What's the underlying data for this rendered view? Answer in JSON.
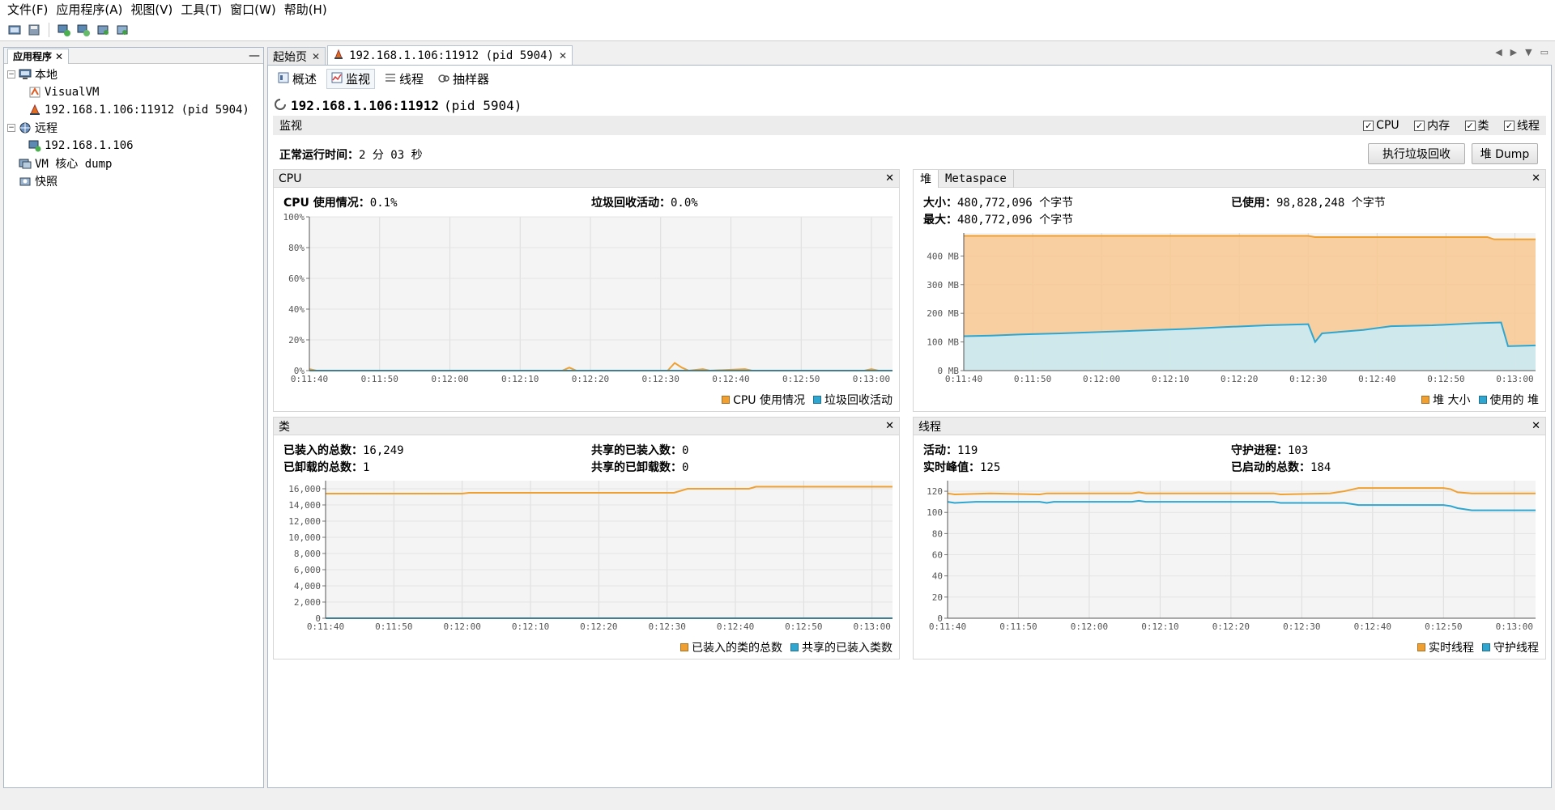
{
  "menu": [
    "文件(F)",
    "应用程序(A)",
    "视图(V)",
    "工具(T)",
    "窗口(W)",
    "帮助(H)"
  ],
  "left_panel": {
    "tab_label": "应用程序",
    "tree": [
      {
        "label": "本地",
        "level": 0,
        "icon": "computer-icon",
        "expand": "−"
      },
      {
        "label": "VisualVM",
        "level": 1,
        "icon": "visualvm-icon"
      },
      {
        "label": "192.168.1.106:11912 (pid 5904)",
        "level": 1,
        "icon": "java-app-icon"
      },
      {
        "label": "远程",
        "level": 0,
        "icon": "network-icon",
        "expand": "−"
      },
      {
        "label": "192.168.1.106",
        "level": 1,
        "icon": "remote-host-icon"
      },
      {
        "label": "VM 核心 dump",
        "level": 0,
        "icon": "core-dump-icon"
      },
      {
        "label": "快照",
        "level": 0,
        "icon": "snapshot-icon"
      }
    ]
  },
  "doc_tabs": [
    {
      "label": "起始页",
      "active": false
    },
    {
      "label": "192.168.1.106:11912 (pid 5904)",
      "active": true
    }
  ],
  "subtabs": [
    "概述",
    "监视",
    "线程",
    "抽样器"
  ],
  "process_title": {
    "host": "192.168.1.106:11912",
    "pid": "(pid 5904)"
  },
  "monitor": {
    "label": "监视",
    "checkboxes": [
      "CPU",
      "内存",
      "类",
      "线程"
    ],
    "uptime_label": "正常运行时间：",
    "uptime_value": "2 分 03 秒",
    "gc_button": "执行垃圾回收",
    "dump_button": "堆 Dump"
  },
  "cpu_panel": {
    "title": "CPU",
    "stats": [
      {
        "label": "CPU 使用情况：",
        "value": "0.1%"
      },
      {
        "label": "垃圾回收活动：",
        "value": "0.0%"
      }
    ],
    "legend": [
      "CPU 使用情况",
      "垃圾回收活动"
    ]
  },
  "heap_panel": {
    "tabs": [
      "堆",
      "Metaspace"
    ],
    "stats": [
      {
        "label": "大小：",
        "value": "480,772,096 个字节"
      },
      {
        "label": "最大：",
        "value": "480,772,096 个字节"
      },
      {
        "label": "已使用：",
        "value": "98,828,248 个字节"
      }
    ],
    "legend": [
      "堆 大小",
      "使用的 堆"
    ]
  },
  "classes_panel": {
    "title": "类",
    "stats": [
      {
        "label": "已装入的总数：",
        "value": "16,249"
      },
      {
        "label": "已卸载的总数：",
        "value": "1"
      },
      {
        "label": "共享的已装入数：",
        "value": "0"
      },
      {
        "label": "共享的已卸载数：",
        "value": "0"
      }
    ],
    "legend": [
      "已装入的类的总数",
      "共享的已装入类数"
    ]
  },
  "threads_panel": {
    "title": "线程",
    "stats": [
      {
        "label": "活动：",
        "value": "119"
      },
      {
        "label": "实时峰值：",
        "value": "125"
      },
      {
        "label": "守护进程：",
        "value": "103"
      },
      {
        "label": "已启动的总数：",
        "value": "184"
      }
    ],
    "legend": [
      "实时线程",
      "守护线程"
    ]
  },
  "colors": {
    "orange": "#f0a030",
    "blue": "#2ea6d0",
    "orange_fill": "#f8c890",
    "blue_fill": "#c8ecf8"
  },
  "chart_data": [
    {
      "type": "line",
      "id": "cpu",
      "x": [
        "0:11:40",
        "0:11:50",
        "0:12:00",
        "0:12:10",
        "0:12:20",
        "0:12:30",
        "0:12:40",
        "0:12:50",
        "0:13:00"
      ],
      "ylim": [
        0,
        100
      ],
      "yticks": [
        "0%",
        "20%",
        "40%",
        "60%",
        "80%",
        "100%"
      ],
      "series": [
        {
          "name": "CPU 使用情况",
          "color": "#f0a030",
          "points": [
            [
              0,
              1
            ],
            [
              1,
              0
            ],
            [
              36,
              0
            ],
            [
              37,
              2
            ],
            [
              38,
              0
            ],
            [
              51,
              0
            ],
            [
              52,
              5
            ],
            [
              53,
              2
            ],
            [
              54,
              0
            ],
            [
              56,
              1
            ],
            [
              57,
              0
            ],
            [
              62,
              1
            ],
            [
              63,
              0
            ],
            [
              79,
              0
            ],
            [
              80,
              1
            ],
            [
              81,
              0
            ]
          ]
        },
        {
          "name": "垃圾回收活动",
          "color": "#2ea6d0",
          "points": [
            [
              0,
              0
            ],
            [
              83,
              0
            ]
          ]
        }
      ]
    },
    {
      "type": "area",
      "id": "heap",
      "x": [
        "0:11:40",
        "0:11:50",
        "0:12:00",
        "0:12:10",
        "0:12:20",
        "0:12:30",
        "0:12:40",
        "0:12:50",
        "0:13:00"
      ],
      "ylim": [
        0,
        480
      ],
      "yticks": [
        "0 MB",
        "100 MB",
        "200 MB",
        "300 MB",
        "400 MB"
      ],
      "series": [
        {
          "name": "堆 大小",
          "color": "#f0a030",
          "points": [
            [
              0,
              470
            ],
            [
              50,
              470
            ],
            [
              51,
              466
            ],
            [
              76,
              466
            ],
            [
              77,
              458
            ],
            [
              83,
              458
            ]
          ]
        },
        {
          "name": "使用的 堆",
          "color": "#2ea6d0",
          "points": [
            [
              0,
              120
            ],
            [
              4,
              122
            ],
            [
              8,
              126
            ],
            [
              14,
              130
            ],
            [
              20,
              135
            ],
            [
              26,
              140
            ],
            [
              32,
              145
            ],
            [
              38,
              152
            ],
            [
              44,
              158
            ],
            [
              50,
              162
            ],
            [
              51,
              100
            ],
            [
              52,
              130
            ],
            [
              58,
              142
            ],
            [
              62,
              155
            ],
            [
              68,
              158
            ],
            [
              74,
              165
            ],
            [
              78,
              168
            ],
            [
              79,
              85
            ],
            [
              83,
              88
            ]
          ]
        }
      ]
    },
    {
      "type": "line",
      "id": "classes",
      "x": [
        "0:11:40",
        "0:11:50",
        "0:12:00",
        "0:12:10",
        "0:12:20",
        "0:12:30",
        "0:12:40",
        "0:12:50",
        "0:13:00"
      ],
      "ylim": [
        0,
        17000
      ],
      "yticks": [
        "0",
        "2,000",
        "4,000",
        "6,000",
        "8,000",
        "10,000",
        "12,000",
        "14,000",
        "16,000"
      ],
      "series": [
        {
          "name": "已装入的类的总数",
          "color": "#f0a030",
          "points": [
            [
              0,
              15400
            ],
            [
              20,
              15400
            ],
            [
              21,
              15500
            ],
            [
              51,
              15500
            ],
            [
              53,
              16000
            ],
            [
              62,
              16000
            ],
            [
              63,
              16249
            ],
            [
              83,
              16249
            ]
          ]
        },
        {
          "name": "共享的已装入类数",
          "color": "#2ea6d0",
          "points": [
            [
              0,
              0
            ],
            [
              83,
              0
            ]
          ]
        }
      ]
    },
    {
      "type": "line",
      "id": "threads",
      "x": [
        "0:11:40",
        "0:11:50",
        "0:12:00",
        "0:12:10",
        "0:12:20",
        "0:12:30",
        "0:12:40",
        "0:12:50",
        "0:13:00"
      ],
      "ylim": [
        0,
        130
      ],
      "yticks": [
        "0",
        "20",
        "40",
        "60",
        "80",
        "100",
        "120"
      ],
      "series": [
        {
          "name": "实时线程",
          "color": "#f0a030",
          "points": [
            [
              0,
              118
            ],
            [
              1,
              117
            ],
            [
              6,
              118
            ],
            [
              13,
              117
            ],
            [
              14,
              118
            ],
            [
              26,
              118
            ],
            [
              27,
              119
            ],
            [
              28,
              118
            ],
            [
              46,
              118
            ],
            [
              47,
              117
            ],
            [
              54,
              118
            ],
            [
              56,
              120
            ],
            [
              58,
              123
            ],
            [
              70,
              123
            ],
            [
              71,
              122
            ],
            [
              72,
              119
            ],
            [
              74,
              118
            ],
            [
              83,
              118
            ]
          ]
        },
        {
          "name": "守护线程",
          "color": "#2ea6d0",
          "points": [
            [
              0,
              110
            ],
            [
              1,
              109
            ],
            [
              4,
              110
            ],
            [
              13,
              110
            ],
            [
              14,
              109
            ],
            [
              15,
              110
            ],
            [
              26,
              110
            ],
            [
              27,
              111
            ],
            [
              28,
              110
            ],
            [
              46,
              110
            ],
            [
              47,
              109
            ],
            [
              56,
              109
            ],
            [
              57,
              108
            ],
            [
              58,
              107
            ],
            [
              70,
              107
            ],
            [
              71,
              106
            ],
            [
              72,
              104
            ],
            [
              74,
              102
            ],
            [
              83,
              102
            ]
          ]
        }
      ]
    }
  ]
}
